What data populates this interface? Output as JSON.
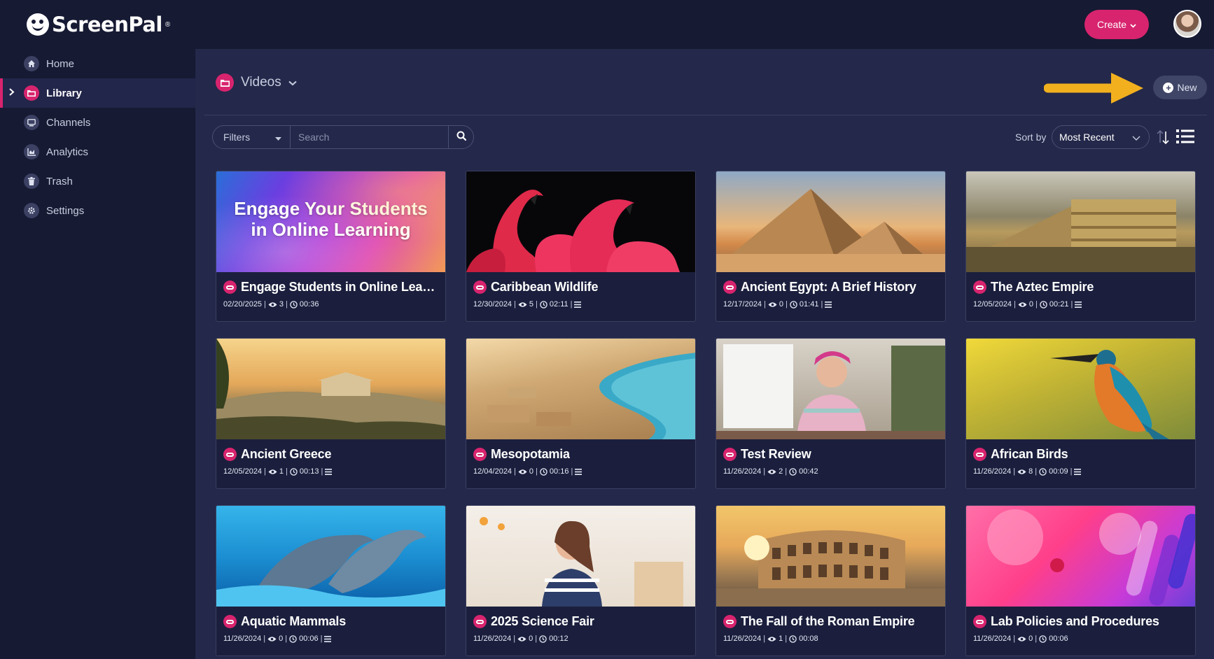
{
  "app": {
    "logo_text": "ScreenPal"
  },
  "sidebar": {
    "items": [
      {
        "label": "Home",
        "icon": "home-icon"
      },
      {
        "label": "Library",
        "icon": "folder-icon",
        "active": true
      },
      {
        "label": "Channels",
        "icon": "channel-icon"
      },
      {
        "label": "Analytics",
        "icon": "chart-icon"
      },
      {
        "label": "Trash",
        "icon": "trash-icon"
      },
      {
        "label": "Settings",
        "icon": "gear-icon"
      }
    ]
  },
  "topbar": {
    "create_label": "Create"
  },
  "header": {
    "title": "Videos",
    "new_label": "New"
  },
  "toolbar": {
    "filters_label": "Filters",
    "search_placeholder": "Search",
    "sort_label": "Sort by",
    "sort_value": "Most Recent"
  },
  "colors": {
    "accent": "#d8246e",
    "sidebar_bg": "#161a33",
    "main_bg": "#24284a",
    "arrow": "#f2b01e"
  },
  "videos": [
    {
      "title": "Engage Students in Online Learn...",
      "thumb_text": "Engage Your Students in Online Learning",
      "date": "02/20/2025",
      "views": "3",
      "duration": "00:36",
      "has_notes": false
    },
    {
      "title": "Caribbean Wildlife",
      "date": "12/30/2024",
      "views": "5",
      "duration": "02:11",
      "has_notes": true
    },
    {
      "title": "Ancient Egypt: A Brief History",
      "date": "12/17/2024",
      "views": "0",
      "duration": "01:41",
      "has_notes": true
    },
    {
      "title": "The Aztec Empire",
      "date": "12/05/2024",
      "views": "0",
      "duration": "00:21",
      "has_notes": true
    },
    {
      "title": "Ancient Greece",
      "date": "12/05/2024",
      "views": "1",
      "duration": "00:13",
      "has_notes": true
    },
    {
      "title": "Mesopotamia",
      "date": "12/04/2024",
      "views": "0",
      "duration": "00:16",
      "has_notes": true
    },
    {
      "title": "Test Review",
      "date": "11/26/2024",
      "views": "2",
      "duration": "00:42",
      "has_notes": false
    },
    {
      "title": "African Birds",
      "date": "11/26/2024",
      "views": "8",
      "duration": "00:09",
      "has_notes": true
    },
    {
      "title": "Aquatic Mammals",
      "date": "11/26/2024",
      "views": "0",
      "duration": "00:06",
      "has_notes": true
    },
    {
      "title": "2025 Science Fair",
      "date": "11/26/2024",
      "views": "0",
      "duration": "00:12",
      "has_notes": false
    },
    {
      "title": "The Fall of the Roman Empire",
      "date": "11/26/2024",
      "views": "1",
      "duration": "00:08",
      "has_notes": false
    },
    {
      "title": "Lab Policies and Procedures",
      "date": "11/26/2024",
      "views": "0",
      "duration": "00:06",
      "has_notes": false
    }
  ]
}
